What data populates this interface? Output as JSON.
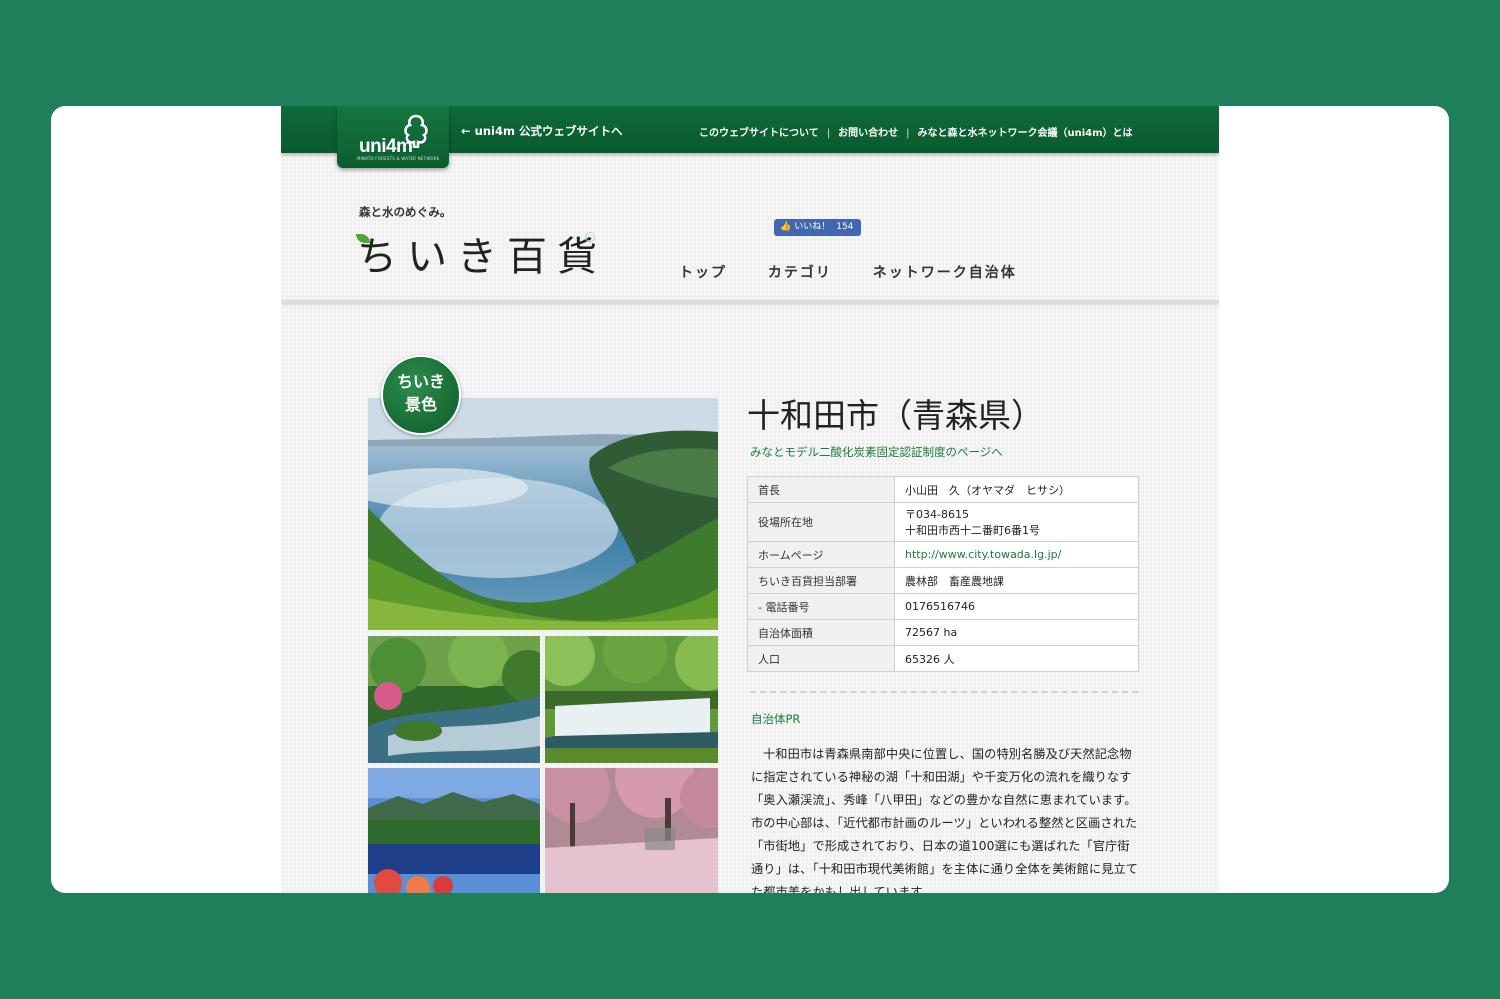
{
  "topbar": {
    "logo_text": "uni4m",
    "logo_subtext": "MINATO FORESTS & WATER NETWORK",
    "back_link": "← uni4m 公式ウェブサイトへ",
    "links": [
      "このウェブサイトについて",
      "お問い合わせ",
      "みなと森と水ネットワーク会議（uni4m）とは"
    ]
  },
  "header": {
    "tagline": "森と水のめぐみ。",
    "brand": "ちいき百貨",
    "like_label": "いいね！",
    "like_count": "154",
    "nav": [
      "トップ",
      "カテゴリ",
      "ネットワーク自治体"
    ]
  },
  "gallery": {
    "badge_line1": "ちいき",
    "badge_line2": "景色"
  },
  "city": {
    "title": "十和田市（青森県）",
    "minato_link": "みなとモデル二酸化炭素固定認証制度のページへ",
    "table": [
      {
        "label": "首長",
        "value": "小山田　久（オヤマダ　ヒサシ）"
      },
      {
        "label": "役場所在地",
        "value": "〒034-8615",
        "value2": "十和田市西十二番町6番1号"
      },
      {
        "label": "ホームページ",
        "value": "http://www.city.towada.lg.jp/"
      },
      {
        "label": "ちいき百貨担当部署",
        "value": "農林部　畜産農地課"
      },
      {
        "label": "- 電話番号",
        "value": "0176516746"
      },
      {
        "label": "自治体面積",
        "value": "72567 ha"
      },
      {
        "label": "人口",
        "value": "65326 人"
      }
    ],
    "pr_heading": "自治体PR",
    "pr_text": "十和田市は青森県南部中央に位置し、国の特別名勝及び天然記念物に指定されている神秘の湖「十和田湖」や千変万化の流れを織りなす「奥入瀬渓流」、秀峰「八甲田」などの豊かな自然に恵まれています。市の中心部は、「近代都市計画のルーツ」といわれる整然と区画された「市街地」で形成されており、日本の道100選にも選ばれた「官庁街通り」は、「十和田市現代美術館」を主体に通り全体を美術館に見立てた都市美をかもし出しています。"
  },
  "colors": {
    "page_bg": "#1e7f5a",
    "topbar_green": "#0f6b3b",
    "link_green": "#1c7a42",
    "like_blue": "#4267b2"
  }
}
